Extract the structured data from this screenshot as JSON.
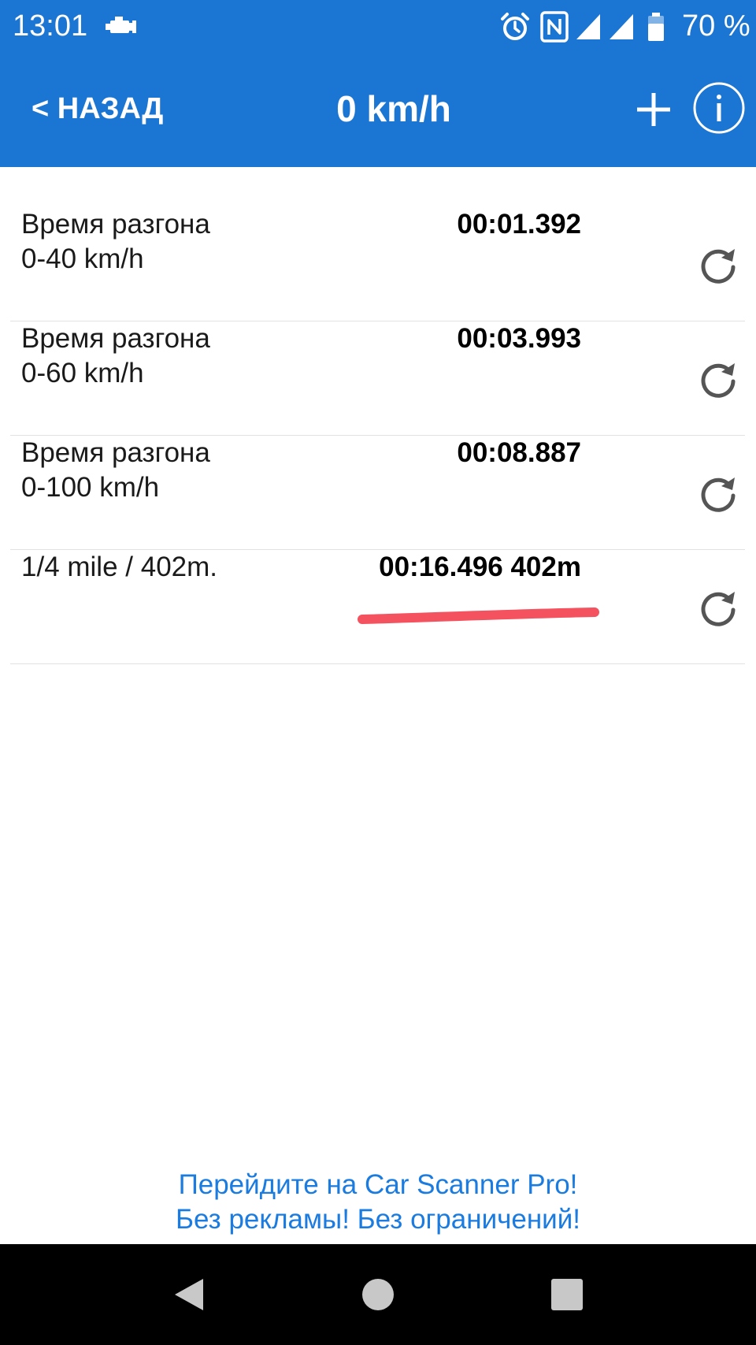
{
  "status_bar": {
    "time": "13:01",
    "battery_text": "70 %",
    "icons": [
      "check-engine-icon",
      "alarm-icon",
      "nfc-icon",
      "signal-icon",
      "signal-icon",
      "battery-icon"
    ]
  },
  "app_bar": {
    "back_label": "< НАЗАД",
    "title": "0 km/h",
    "actions": [
      "plus-icon",
      "info-icon"
    ]
  },
  "results": [
    {
      "label_line1": "Время разгона",
      "label_line2": "0-40 km/h",
      "value": "00:01.392"
    },
    {
      "label_line1": "Время разгона",
      "label_line2": "0-60 km/h",
      "value": "00:03.993"
    },
    {
      "label_line1": "Время разгона",
      "label_line2": "0-100 km/h",
      "value": "00:08.887"
    },
    {
      "label_line1": "1/4 mile / 402m.",
      "label_line2": "",
      "value": "00:16.496 402m"
    }
  ],
  "promo": {
    "line1": "Перейдите на Car Scanner Pro!",
    "line2": "Без рекламы! Без ограничений!"
  },
  "colors": {
    "header_bg": "#1b75d2",
    "promo_text": "#1a7be0",
    "highlight_mark": "#f4525f",
    "nav_bg": "#000000"
  }
}
